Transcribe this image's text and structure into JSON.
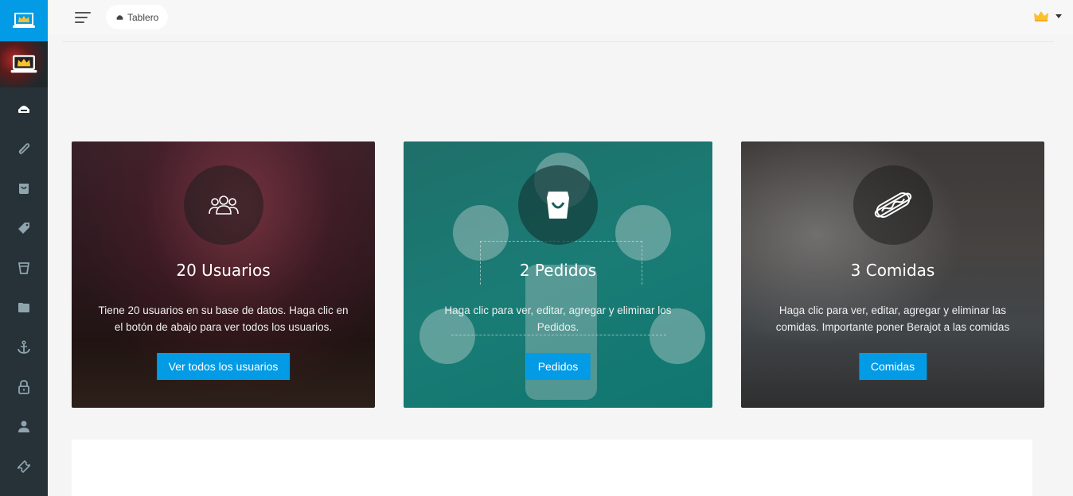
{
  "header": {
    "breadcrumb_label": "Tablero"
  },
  "sidebar": {
    "items": [
      {
        "icon": "dashboard-icon"
      },
      {
        "icon": "paperclip-icon"
      },
      {
        "icon": "bag-icon"
      },
      {
        "icon": "tag-icon"
      },
      {
        "icon": "cup-icon"
      },
      {
        "icon": "folder-icon"
      },
      {
        "icon": "anchor-icon"
      },
      {
        "icon": "lock-icon"
      },
      {
        "icon": "user-icon"
      },
      {
        "icon": "ticket-icon"
      }
    ]
  },
  "cards": [
    {
      "title": "20 Usuarios",
      "description": "Tiene 20 usuarios en su base de datos. Haga clic en el botón de abajo para ver todos los usuarios.",
      "button": "Ver todos los usuarios",
      "icon": "users-icon"
    },
    {
      "title": "2 Pedidos",
      "description": "Haga clic para ver, editar, agregar y eliminar los Pedidos.",
      "button": "Pedidos",
      "icon": "shopping-bag-icon"
    },
    {
      "title": "3 Comidas",
      "description": "Haga clic para ver, editar, agregar y eliminar las comidas. Importante poner Berajot a las comidas",
      "button": "Comidas",
      "icon": "hotdog-icon"
    }
  ],
  "colors": {
    "sidebar_bg": "#263238",
    "accent": "#039be5"
  }
}
